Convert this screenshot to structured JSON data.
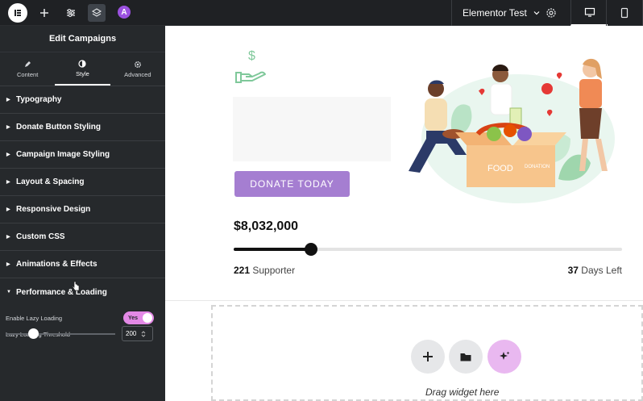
{
  "topbar": {
    "site_name": "Elementor Test",
    "ai_badge": "A",
    "icons": [
      "elementor-logo-icon",
      "add-icon",
      "settings-sliders-icon",
      "layers-icon",
      "ai-icon",
      "chevron-down-icon",
      "gear-icon",
      "desktop-icon",
      "mobile-icon"
    ]
  },
  "panel": {
    "title": "Edit Campaigns",
    "tabs": [
      {
        "label": "Content",
        "icon": "pencil-icon"
      },
      {
        "label": "Style",
        "icon": "half-circle-icon"
      },
      {
        "label": "Advanced",
        "icon": "gear-icon"
      }
    ],
    "active_tab": "Style",
    "sections": [
      {
        "label": "Typography",
        "expanded": false
      },
      {
        "label": "Donate Button Styling",
        "expanded": false
      },
      {
        "label": "Campaign Image Styling",
        "expanded": false
      },
      {
        "label": "Layout & Spacing",
        "expanded": false
      },
      {
        "label": "Responsive Design",
        "expanded": false
      },
      {
        "label": "Custom CSS",
        "expanded": false
      },
      {
        "label": "Animations & Effects",
        "expanded": false
      },
      {
        "label": "Performance & Loading",
        "expanded": true
      }
    ],
    "controls": {
      "lazy_loading_label": "Enable Lazy Loading",
      "lazy_loading_value": "Yes",
      "threshold_label": "Lazy Loading Threshold",
      "threshold_value": "200"
    }
  },
  "campaign": {
    "donate_label": "DONATE TODAY",
    "amount": "$8,032,000",
    "progress_fraction": 0.2,
    "supporters_count": "221",
    "supporters_label": "Supporter",
    "days_count": "37",
    "days_label": "Days Left",
    "illustration_labels": {
      "box_left": "FOOD",
      "box_right": "DONATION"
    }
  },
  "dropzone": {
    "text": "Drag widget here",
    "buttons": [
      "add-icon",
      "folder-icon",
      "ai-sparkle-icon"
    ]
  },
  "colors": {
    "accent": "#a57ed1",
    "toggle": "#e389e6",
    "panel": "#26292c",
    "ai": "#e9b8f0"
  }
}
